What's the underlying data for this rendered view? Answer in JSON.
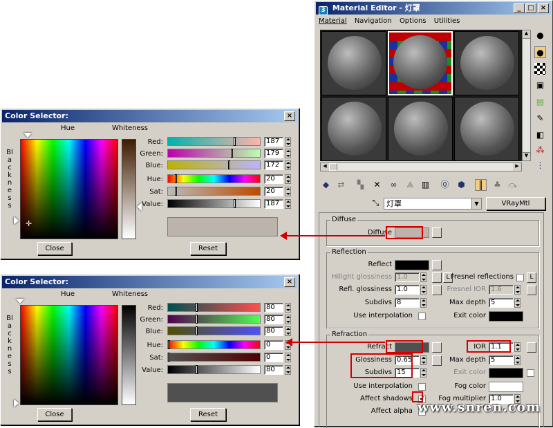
{
  "material_editor": {
    "title": "Material Editor - 灯罩",
    "menu": [
      "Material",
      "Navigation",
      "Options",
      "Utilities"
    ],
    "material_name": "灯罩",
    "material_type": "VRayMtl",
    "diffuse": {
      "header": "Diffuse",
      "label": "Diffuse",
      "color": "#bbb3ac"
    },
    "reflection": {
      "header": "Reflection",
      "reflect_label": "Reflect",
      "hilight_label": "Hilight glossiness",
      "hilight_value": "1.0",
      "l_button": "L",
      "fresnel_label": "Fresnel reflections",
      "refl_gloss_label": "Refl. glossiness",
      "refl_gloss_value": "1.0",
      "fresnel_ior_label": "Fresnel IOR",
      "fresnel_ior_value": "1.6",
      "subdivs_label": "Subdivs",
      "subdivs_value": "8",
      "max_depth_label": "Max depth",
      "max_depth_value": "5",
      "use_interp_label": "Use interpolation",
      "exit_color_label": "Exit color"
    },
    "refraction": {
      "header": "Refraction",
      "refract_label": "Refract",
      "refract_color": "#505050",
      "ior_label": "IOR",
      "ior_value": "1.1",
      "glossiness_label": "Glossiness",
      "glossiness_value": "0.65",
      "max_depth_label": "Max depth",
      "max_depth_value": "5",
      "subdivs_label": "Subdivs",
      "subdivs_value": "15",
      "exit_color_label": "Exit color",
      "use_interp_label": "Use interpolation",
      "fog_color_label": "Fog color",
      "affect_shadows_label": "Affect shadows",
      "fog_multiplier_label": "Fog multiplier",
      "fog_multiplier_value": "1.0",
      "affect_alpha_label": "Affect alpha"
    }
  },
  "color_selector_1": {
    "title": "Color Selector:",
    "hue_label": "Hue",
    "whiteness_label": "Whiteness",
    "blackness_label": "Blackness",
    "red_label": "Red:",
    "red_value": "187",
    "red_level": 187,
    "green_label": "Green:",
    "green_value": "179",
    "green_level": 179,
    "blue_label": "Blue:",
    "blue_value": "172",
    "blue_level": 172,
    "hue_ch_label": "Hue:",
    "hue_value": "20",
    "hue_level": 20,
    "sat_label": "Sat:",
    "sat_value": "20",
    "sat_level": 20,
    "val_label": "Value:",
    "val_value": "187",
    "val_level": 187,
    "preview_color": "#bbb3ac",
    "close_label": "Close",
    "reset_label": "Reset"
  },
  "color_selector_2": {
    "title": "Color Selector:",
    "hue_label": "Hue",
    "whiteness_label": "Whiteness",
    "blackness_label": "Blackness",
    "red_label": "Red:",
    "red_value": "80",
    "red_level": 80,
    "green_label": "Green:",
    "green_value": "80",
    "green_level": 80,
    "blue_label": "Blue:",
    "blue_value": "80",
    "blue_level": 80,
    "hue_ch_label": "Hue:",
    "hue_value": "0",
    "hue_level": 0,
    "sat_label": "Sat:",
    "sat_value": "0",
    "sat_level": 0,
    "val_label": "Value:",
    "val_value": "80",
    "val_level": 80,
    "preview_color": "#505050",
    "close_label": "Close",
    "reset_label": "Reset"
  },
  "watermark": "www.snren.com"
}
